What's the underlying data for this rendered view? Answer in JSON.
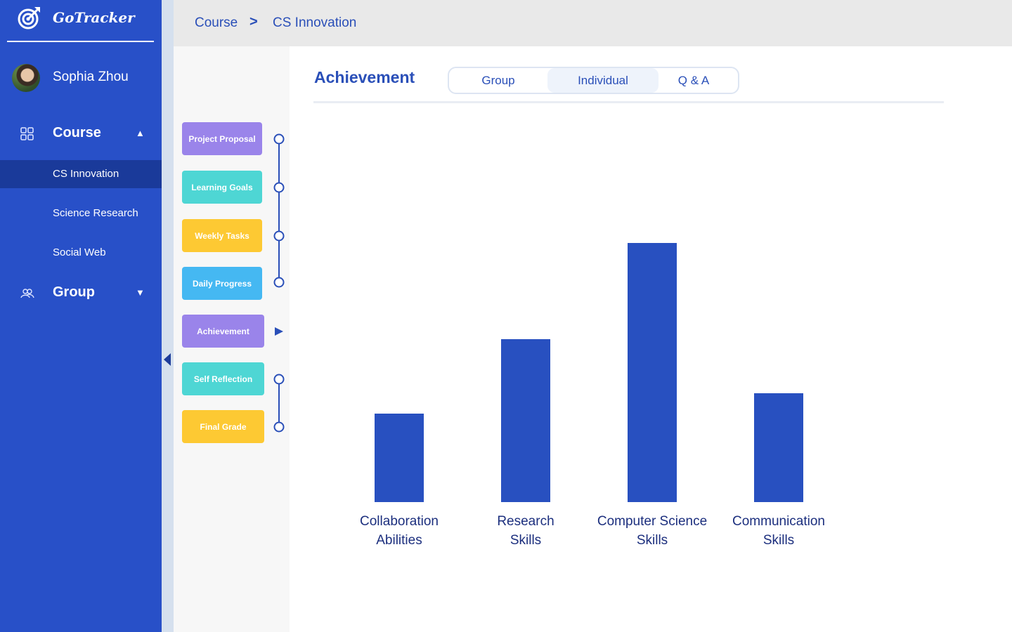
{
  "app": {
    "name": "GoTracker"
  },
  "user": {
    "name": "Sophia Zhou"
  },
  "sidebar": {
    "sections": [
      {
        "label": "Course",
        "icon": "grid-icon",
        "expanded": true,
        "items": [
          {
            "label": "CS Innovation",
            "active": true
          },
          {
            "label": "Science Research",
            "active": false
          },
          {
            "label": "Social Web",
            "active": false
          }
        ]
      },
      {
        "label": "Group",
        "icon": "people-icon",
        "expanded": false,
        "items": []
      }
    ]
  },
  "breadcrumb": {
    "items": [
      "Course",
      "CS Innovation"
    ],
    "separator": ">"
  },
  "steps": [
    {
      "label": "Project Proposal",
      "color": "#9a84ea",
      "marker": "circle"
    },
    {
      "label": "Learning Goals",
      "color": "#4ed6d4",
      "marker": "circle"
    },
    {
      "label": "Weekly Tasks",
      "color": "#fdc933",
      "marker": "circle"
    },
    {
      "label": "Daily Progress",
      "color": "#45b8f2",
      "marker": "circle"
    },
    {
      "label": "Achievement",
      "color": "#9a84ea",
      "marker": "current-arrow"
    },
    {
      "label": "Self Reflection",
      "color": "#4ed6d4",
      "marker": "circle"
    },
    {
      "label": "Final Grade",
      "color": "#fdc933",
      "marker": "circle"
    }
  ],
  "main": {
    "title": "Achievement",
    "tabs": [
      {
        "label": "Group",
        "active": false
      },
      {
        "label": "Individual",
        "active": true
      },
      {
        "label": "Q & A",
        "active": false
      }
    ]
  },
  "colors": {
    "accent": "#2a4fb8",
    "sidebar": "#2850c8",
    "bar": "#2850c0"
  },
  "chart_data": {
    "type": "bar",
    "categories": [
      [
        "Collaboration",
        "Abilities"
      ],
      [
        "Research",
        "Skills"
      ],
      [
        "Computer Science",
        "Skills"
      ],
      [
        "Communication",
        "Skills"
      ]
    ],
    "values": [
      126,
      232,
      369,
      155
    ],
    "ylim": [
      0,
      560
    ],
    "grid": false,
    "legend": "none",
    "title": "",
    "xlabel": "",
    "ylabel": ""
  }
}
